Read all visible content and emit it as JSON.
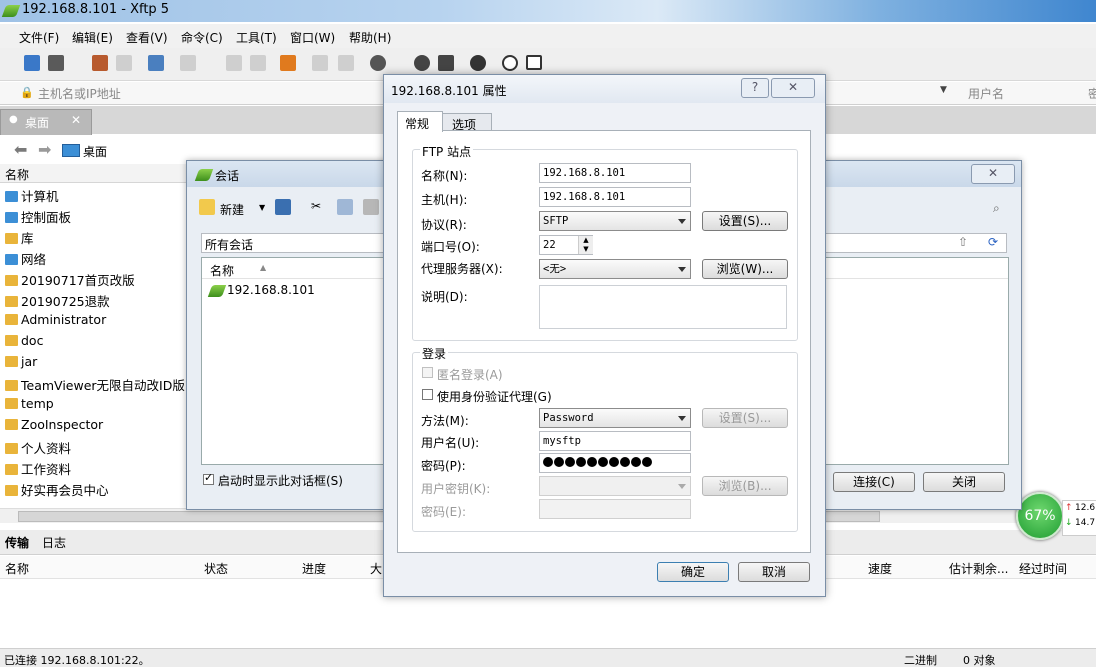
{
  "window": {
    "title": "192.168.8.101   - Xftp 5"
  },
  "menu": [
    "文件(F)",
    "编辑(E)",
    "查看(V)",
    "命令(C)",
    "工具(T)",
    "窗口(W)",
    "帮助(H)"
  ],
  "address": {
    "placeholder": "主机名或IP地址",
    "user_placeholder": "用户名",
    "pwd_placeholder": "密"
  },
  "tab": {
    "label": "桌面"
  },
  "nav": {
    "path": "桌面"
  },
  "left_panel": {
    "header": "名称",
    "items": [
      "计算机",
      "控制面板",
      "库",
      "网络",
      "20190717首页改版",
      "20190725退款",
      "Administrator",
      "doc",
      "jar",
      "TeamViewer无限自动改ID版",
      "temp",
      "ZooInspector",
      "个人资料",
      "工作资料",
      "好实再会员中心"
    ]
  },
  "session_dialog": {
    "title": "会话",
    "new_label": "新建",
    "folder_label": "所有会话",
    "list_header": "名称",
    "sessions": [
      "192.168.8.101"
    ],
    "show_on_start": "启动时显示此对话框(S)",
    "connect": "连接(C)",
    "close": "关闭"
  },
  "props_dialog": {
    "title": "192.168.8.101 属性",
    "help_btn": "?",
    "tabs": [
      "常规",
      "选项"
    ],
    "ftp_group": "FTP 站点",
    "name_label": "名称(N):",
    "name_value": "192.168.8.101",
    "host_label": "主机(H):",
    "host_value": "192.168.8.101",
    "protocol_label": "协议(R):",
    "protocol_value": "SFTP",
    "settings_btn": "设置(S)...",
    "port_label": "端口号(O):",
    "port_value": "22",
    "proxy_label": "代理服务器(X):",
    "proxy_value": "<无>",
    "browse_btn": "浏览(W)...",
    "desc_label": "说明(D):",
    "login_group": "登录",
    "anon_label": "匿名登录(A)",
    "agent_label": "使用身份验证代理(G)",
    "method_label": "方法(M):",
    "method_value": "Password",
    "method_settings_btn": "设置(S)...",
    "user_label": "用户名(U):",
    "user_value": "mysftp",
    "pwd_label": "密码(P):",
    "pwd_dots": 10,
    "key_label": "用户密钥(K):",
    "key_browse_btn": "浏览(B)...",
    "passphrase_label": "密码(E):",
    "ok": "确定",
    "cancel": "取消"
  },
  "transfer": {
    "tabs": [
      "传输",
      "日志"
    ],
    "columns": [
      "名称",
      "状态",
      "进度",
      "大",
      "速度",
      "估计剩余...",
      "经过时间"
    ]
  },
  "status": {
    "left": "已连接 192.168.8.101:22。",
    "mode": "二进制",
    "objects": "0 对象"
  },
  "gauge": {
    "percent": "67%",
    "up": "12.6",
    "down": "14.7"
  },
  "colors": {
    "accent": "#3c8fd6",
    "gauge": "#2aa63b",
    "folder": "#e9b43a"
  }
}
